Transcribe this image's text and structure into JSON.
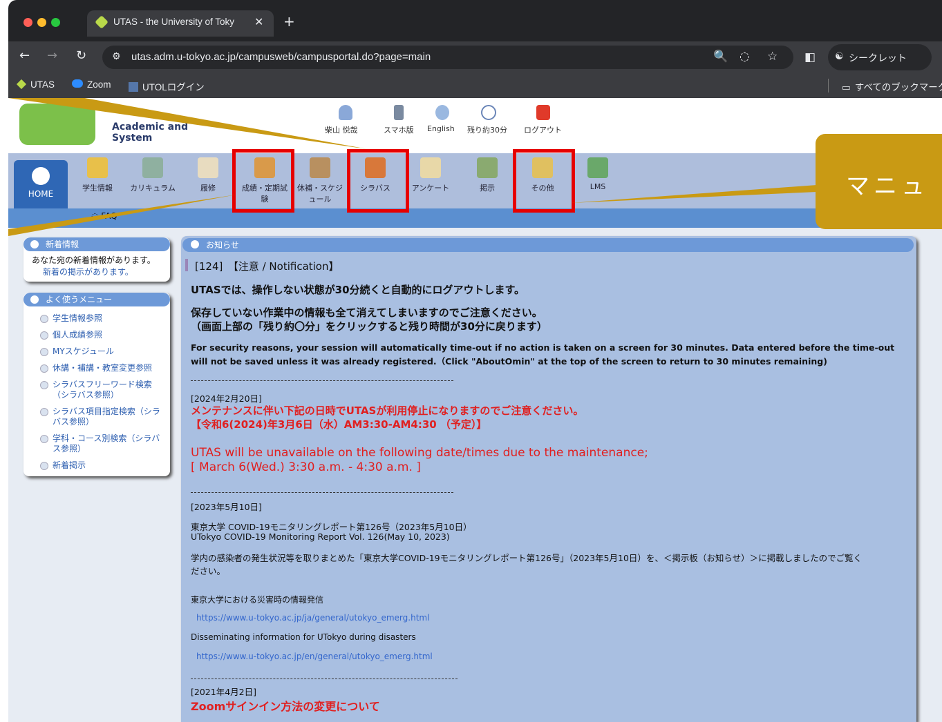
{
  "browser": {
    "tab_title": "UTAS - the University of Toky",
    "url": "utas.adm.u-tokyo.ac.jp/campusweb/campusportal.do?page=main",
    "incognito_label": "シークレット",
    "bookmarks": [
      "UTAS",
      "Zoom",
      "UTOLログイン"
    ],
    "all_bookmarks": "すべてのブックマーク"
  },
  "header": {
    "logo_text": "Academic and\nSystem",
    "user_name": "柴山 悦哉",
    "links": [
      "スマホ版",
      "English",
      "残り約30分",
      "ログアウト"
    ]
  },
  "menu": {
    "home": "HOME",
    "items": [
      "学生情報",
      "カリキュラム",
      "履修",
      "成績・定期試験",
      "休補・スケジュール",
      "シラバス",
      "アンケート",
      "掲示",
      "その他",
      "LMS"
    ],
    "faq": "FAQ"
  },
  "callout": {
    "text": "マニュ"
  },
  "sidebar": {
    "news_title": "新着情報",
    "news_line1": "あなた宛の新着情報があります。",
    "news_line2": "新着の掲示があります。",
    "menu_title": "よく使うメニュー",
    "menu_items": [
      "学生情報参照",
      "個人成績参照",
      "MYスケジュール",
      "休講・補講・教室変更参照",
      "シラバスフリーワード検索（シラバス参照）",
      "シラバス項目指定検索（シラバス参照）",
      "学科・コース別検索（シラバス参照）",
      "新着掲示"
    ]
  },
  "notice": {
    "header": "お知らせ",
    "id_line": "[124]　【注意 / Notification】",
    "line1": "UTASでは、操作しない状態が30分続くと自動的にログアウトします。",
    "line2": "保存していない作業中の情報も全て消えてしまいますのでご注意ください。",
    "line3": "（画面上部の「残り約〇分」をクリックすると残り時間が30分に戻ります）",
    "en1": "For security reasons, your session will automatically time-out if no action is taken on a screen for 30 minutes. Data entered before the time-out",
    "en2": "will not be saved unless it was already registered.（Click \"AboutOmin\" at the top of the screen to return to 30 minutes remaining)",
    "date1": "[2024年2月20日]",
    "maint_jp1": "メンテナンスに伴い下記の日時でUTASが利用停止になりますのでご注意ください。",
    "maint_jp2": "【令和6(2024)年3月6日（水）AM3:30-AM4:30 （予定）】",
    "maint_en1": "UTAS will be unavailable on the  following date/times due to the maintenance;",
    "maint_en2": "[ March 6(Wed.) 3:30 a.m. - 4:30 a.m. ]",
    "date2": "[2023年5月10日]",
    "covid1": "東京大学 COVID-19モニタリングレポート第126号（2023年5月10日）",
    "covid2": "UTokyo COVID-19 Monitoring Report Vol. 126(May 10, 2023)",
    "covid3": "学内の感染者の発生状況等を取りまとめた「東京大学COVID-19モニタリングレポート第126号」（2023年5月10日）を、＜掲示板（お知らせ）＞に掲載しましたのでご覧く",
    "covid4": "ださい。",
    "disaster_jp": "東京大学における災害時の情報発信",
    "link_jp": "https://www.u-tokyo.ac.jp/ja/general/utokyo_emerg.html",
    "disaster_en": "Disseminating information for UTokyo during disasters",
    "link_en": "https://www.u-tokyo.ac.jp/en/general/utokyo_emerg.html",
    "date3": "[2021年4月2日]",
    "zoom": "Zoomサインイン方法の変更について"
  }
}
